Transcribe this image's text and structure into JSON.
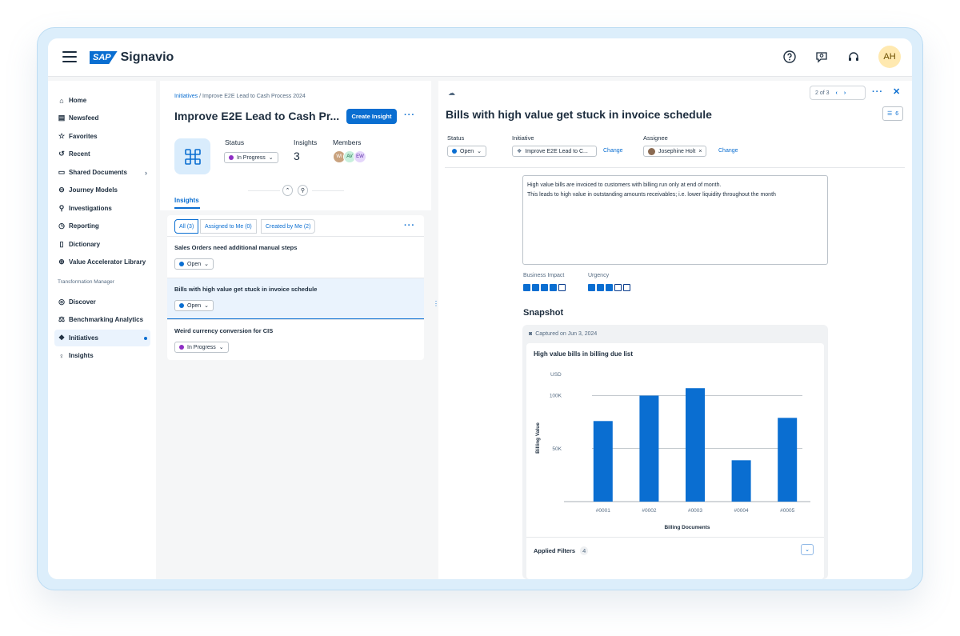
{
  "shell": {
    "brand": "Signavio",
    "logo": "SAP",
    "avatar_initials": "AH",
    "icons": [
      "help-icon",
      "feedback-icon",
      "support-icon"
    ]
  },
  "sidebar": {
    "items": [
      {
        "label": "Home",
        "icon": "home-icon"
      },
      {
        "label": "Newsfeed",
        "icon": "newsfeed-icon"
      },
      {
        "label": "Favorites",
        "icon": "star-icon"
      },
      {
        "label": "Recent",
        "icon": "history-icon"
      },
      {
        "label": "Shared Documents",
        "icon": "folder-icon"
      },
      {
        "label": "Journey Models",
        "icon": "journey-icon"
      },
      {
        "label": "Investigations",
        "icon": "investigation-icon"
      },
      {
        "label": "Reporting",
        "icon": "reporting-icon"
      },
      {
        "label": "Dictionary",
        "icon": "dictionary-icon"
      },
      {
        "label": "Value Accelerator Library",
        "icon": "globe-icon"
      }
    ],
    "section_title": "Transformation Manager",
    "tm_items": [
      {
        "label": "Discover",
        "icon": "compass-icon"
      },
      {
        "label": "Benchmarking Analytics",
        "icon": "scale-icon"
      },
      {
        "label": "Initiatives",
        "icon": "initiative-icon"
      },
      {
        "label": "Insights",
        "icon": "lightbulb-icon"
      }
    ]
  },
  "initiative": {
    "breadcrumb_root": "Initiatives",
    "breadcrumb_current": "Improve E2E Lead to Cash Process 2024",
    "title": "Improve E2E Lead to Cash Pr...",
    "create_button": "Create Insight",
    "status_label": "Status",
    "status_value": "In Progress",
    "insights_label": "Insights",
    "insights_count": "3",
    "members_label": "Members",
    "members": [
      "WI",
      "AV",
      "EW"
    ],
    "tab": "Insights",
    "filters": [
      "All (3)",
      "Assigned to Me (0)",
      "Created by Me (2)"
    ],
    "rows": [
      {
        "title": "Sales Orders need additional manual steps",
        "status": "Open"
      },
      {
        "title": "Bills with high value get stuck in invoice schedule",
        "status": "Open"
      },
      {
        "title": "Weird currency conversion for CIS",
        "status": "In Progress"
      }
    ]
  },
  "detail": {
    "pager": "2 of 3",
    "title": "Bills with high value get stuck in invoice schedule",
    "comments_count": "6",
    "status_label": "Status",
    "status_value": "Open",
    "initiative_label": "Initiative",
    "initiative_value": "Improve E2E Lead to C...",
    "change_label": "Change",
    "assignee_label": "Assignee",
    "assignee_value": "Josephine Holt",
    "description_line1": "High value bills are invoiced to customers with billing run only at end of month.",
    "description_line2": "This leads to high value in outstanding amounts receivables; i.e. lower liquidity throughout the month",
    "business_impact_label": "Business Impact",
    "business_impact_level": 4,
    "urgency_label": "Urgency",
    "urgency_level": 3,
    "rating_max": 5,
    "snapshot_title": "Snapshot",
    "captured": "Captured on Jun 3, 2024",
    "applied_filters_label": "Applied Filters",
    "applied_filters_count": "4"
  },
  "colors": {
    "accent": "#0a6ed1",
    "open": "#0a6ed1",
    "in_progress": "#8e2ec4",
    "bar": "#0a6ed1"
  },
  "chart_data": {
    "type": "bar",
    "title": "High value bills in billing due list",
    "xlabel": "Billing Documents",
    "ylabel": "Billing Value",
    "unit": "USD",
    "categories": [
      "#0001",
      "#0002",
      "#0003",
      "#0004",
      "#0005"
    ],
    "values": [
      76000,
      100000,
      107000,
      39000,
      79000
    ],
    "ylim": [
      0,
      120000
    ],
    "yticks": [
      {
        "value": 50000,
        "label": "50K"
      },
      {
        "value": 100000,
        "label": "100K"
      }
    ]
  }
}
